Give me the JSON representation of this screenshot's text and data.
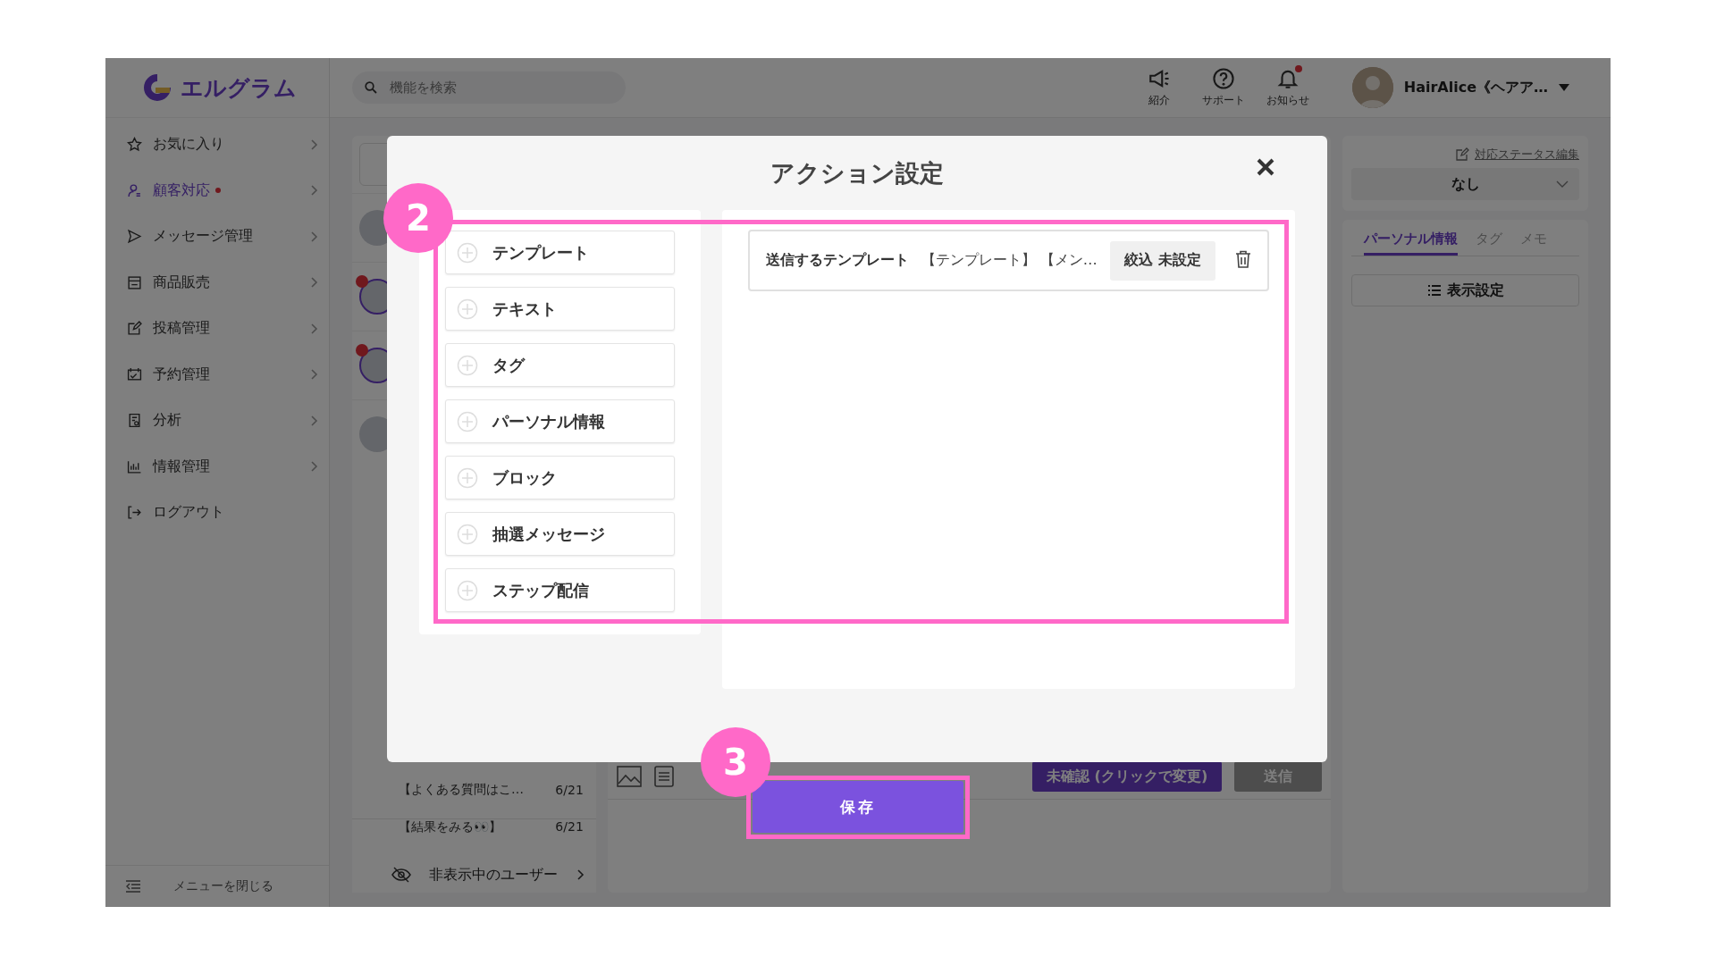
{
  "header": {
    "logo": "エルグラム",
    "search": {
      "placeholder": "機能を検索"
    },
    "icons": [
      {
        "kind": "speaker",
        "label": "紹介",
        "badge": false
      },
      {
        "kind": "help",
        "label": "サポート",
        "badge": false
      },
      {
        "kind": "bell",
        "label": "お知らせ",
        "badge": true
      }
    ],
    "user": {
      "name": "HairAlice《ヘアア…"
    }
  },
  "sidebar": {
    "items": [
      {
        "label": "お気に入り",
        "selected": false,
        "badge": false,
        "submenu": true
      },
      {
        "label": "顧客対応",
        "selected": true,
        "badge": true,
        "submenu": true
      },
      {
        "label": "メッセージ管理",
        "selected": false,
        "badge": false,
        "submenu": true
      },
      {
        "label": "商品販売",
        "selected": false,
        "badge": false,
        "submenu": true
      },
      {
        "label": "投稿管理",
        "selected": false,
        "badge": false,
        "submenu": true
      },
      {
        "label": "予約管理",
        "selected": false,
        "badge": false,
        "submenu": true
      },
      {
        "label": "分析",
        "selected": false,
        "badge": false,
        "submenu": true
      },
      {
        "label": "情報管理",
        "selected": false,
        "badge": false,
        "submenu": true
      },
      {
        "label": "ログアウト",
        "selected": false,
        "badge": false,
        "submenu": false
      }
    ],
    "collapse": "メニューを閉じる"
  },
  "chat_list": {
    "contacts": [
      {
        "unread": false
      },
      {
        "unread": true
      },
      {
        "unread": true
      },
      {
        "unread": false
      }
    ],
    "rows": [
      {
        "title": "【よくある質問はこ…",
        "date": "6/21"
      },
      {
        "title": "【結果をみる👀】",
        "date": "6/21"
      }
    ],
    "hidden_users": "非表示中のユーザー"
  },
  "composer": {
    "status_button": "未確認 (クリックで変更)",
    "send_button": "送信"
  },
  "right_panel": {
    "status_edit": "対応ステータス編集",
    "status_value": "なし",
    "tabs": [
      {
        "label": "パーソナル情報",
        "selected": true
      },
      {
        "label": "タグ",
        "selected": false
      },
      {
        "label": "メモ",
        "selected": false
      }
    ],
    "display_settings": "表示設定"
  },
  "modal": {
    "title": "アクション設定",
    "actions": [
      "テンプレート",
      "テキスト",
      "タグ",
      "パーソナル情報",
      "ブロック",
      "抽選メッセージ",
      "ステップ配信"
    ],
    "selected_actions": [
      {
        "label": "送信するテンプレート",
        "value": "【テンプレート】 【メン…",
        "filter": "絞込 未設定"
      }
    ],
    "save_button": "保存"
  },
  "annotations": [
    {
      "number": "2"
    },
    {
      "number": "3"
    }
  ]
}
